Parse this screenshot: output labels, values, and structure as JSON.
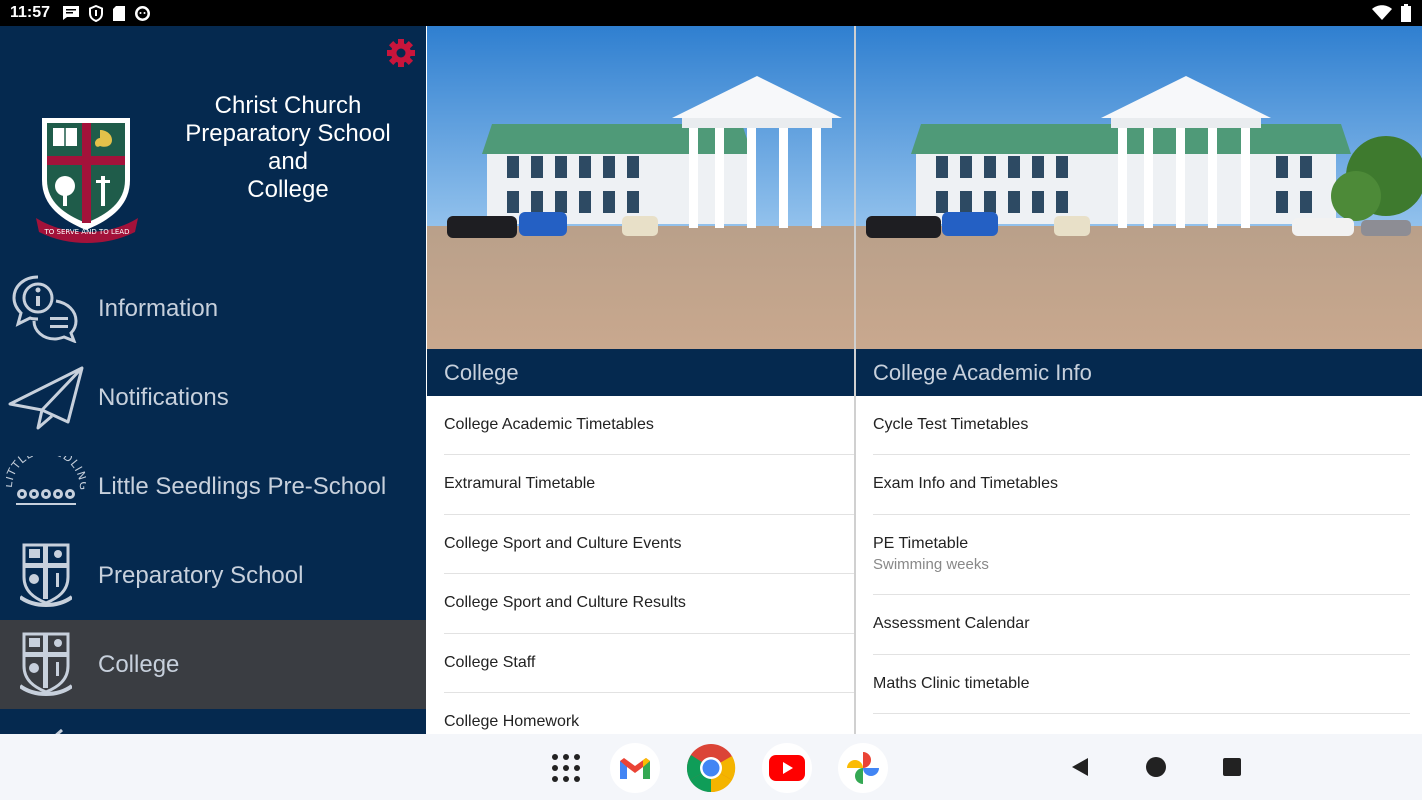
{
  "status_bar": {
    "time": "11:57",
    "left_icons": [
      "message-icon",
      "shield-icon",
      "sd-card-icon",
      "face-icon"
    ],
    "right_icons": [
      "wifi-icon",
      "battery-icon"
    ]
  },
  "drawer": {
    "school_name_lines": [
      "Christ Church",
      "Preparatory School",
      "and",
      "College"
    ],
    "crest_motto": "TO SERVE AND TO LEAD",
    "menu": [
      {
        "label": "Information",
        "icon": "info-chat-icon"
      },
      {
        "label": "Notifications",
        "icon": "paper-plane-icon"
      },
      {
        "label": "Little Seedlings Pre-School",
        "icon": "little-seedlings-logo-icon"
      },
      {
        "label": "Preparatory School",
        "icon": "school-crest-icon"
      },
      {
        "label": "College",
        "icon": "school-crest-icon",
        "active": true
      }
    ]
  },
  "left_column": {
    "header": "College",
    "items": [
      {
        "title": "College Academic Timetables"
      },
      {
        "title": "Extramural Timetable"
      },
      {
        "title": "College Sport and Culture Events"
      },
      {
        "title": "College Sport and Culture Results"
      },
      {
        "title": "College Staff"
      },
      {
        "title": "College Homework"
      }
    ]
  },
  "right_column": {
    "header": "College Academic Info",
    "items": [
      {
        "title": "Cycle Test Timetables"
      },
      {
        "title": "Exam Info and Timetables"
      },
      {
        "title": "PE Timetable",
        "subtitle": "Swimming weeks"
      },
      {
        "title": "Assessment Calendar"
      },
      {
        "title": "Maths Clinic timetable"
      }
    ]
  },
  "nav_bar": {
    "dock": [
      "app-drawer-icon",
      "gmail-icon",
      "chrome-icon",
      "youtube-icon",
      "photos-icon"
    ],
    "buttons": [
      "back-button",
      "home-button",
      "recents-button"
    ]
  },
  "colors": {
    "navy": "#05294f",
    "active_item": "#3a3d42",
    "gear": "#c8153c",
    "crest_red": "#a3123a"
  }
}
